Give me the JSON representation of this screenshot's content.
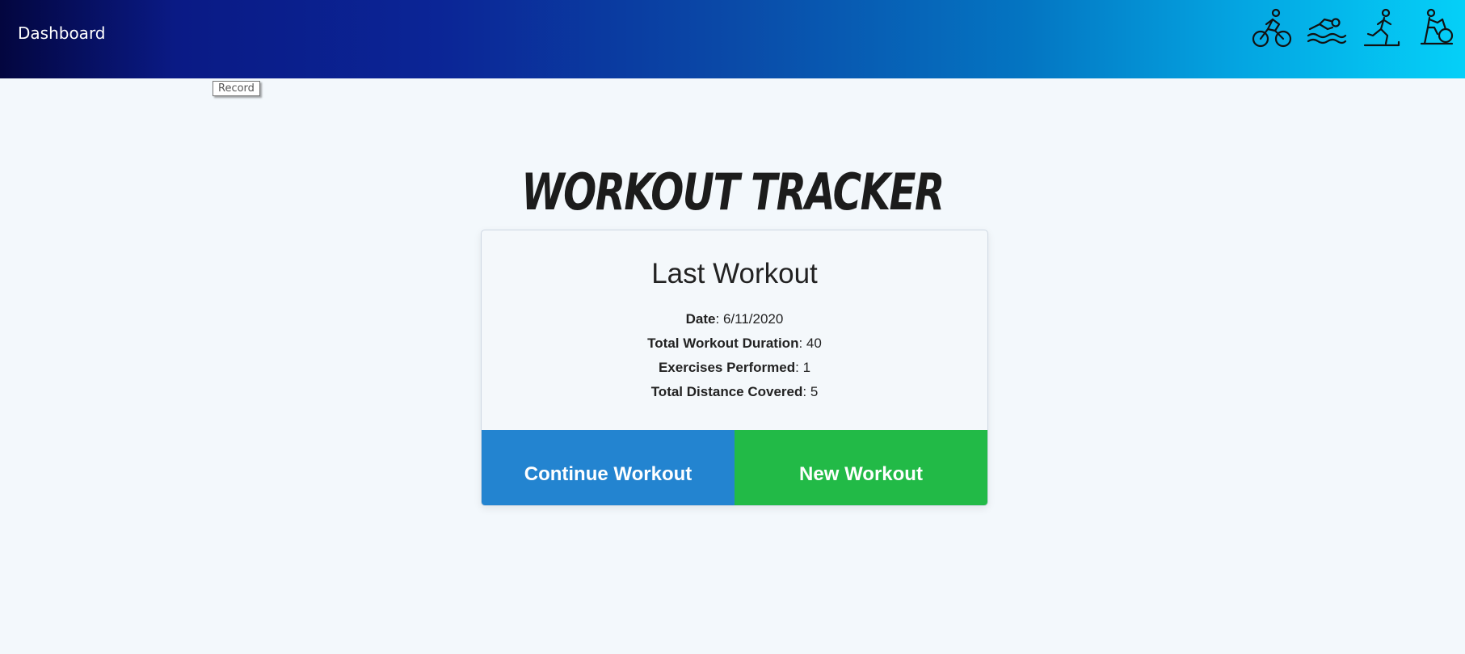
{
  "nav": {
    "dashboard_label": "Dashboard",
    "gradient_colors": [
      "#03063f",
      "#0b2596",
      "#0475c2",
      "#05d0f8"
    ],
    "icons": [
      "cyclist-icon",
      "swimmer-icon",
      "runner-icon",
      "exercise-bike-icon"
    ]
  },
  "tooltip": {
    "text": "Record"
  },
  "header": {
    "title": "Workout Tracker"
  },
  "card": {
    "title": "Last Workout",
    "date_label": "Date",
    "date_value": "6/11/2020",
    "duration_label": "Total Workout Duration",
    "duration_value": "40",
    "exercises_label": "Exercises Performed",
    "exercises_value": "1",
    "distance_label": "Total Distance Covered",
    "distance_value": "5"
  },
  "buttons": {
    "continue_label": "Continue Workout",
    "continue_color": "#2384d0",
    "new_label": "New Workout",
    "new_color": "#22ba47"
  }
}
